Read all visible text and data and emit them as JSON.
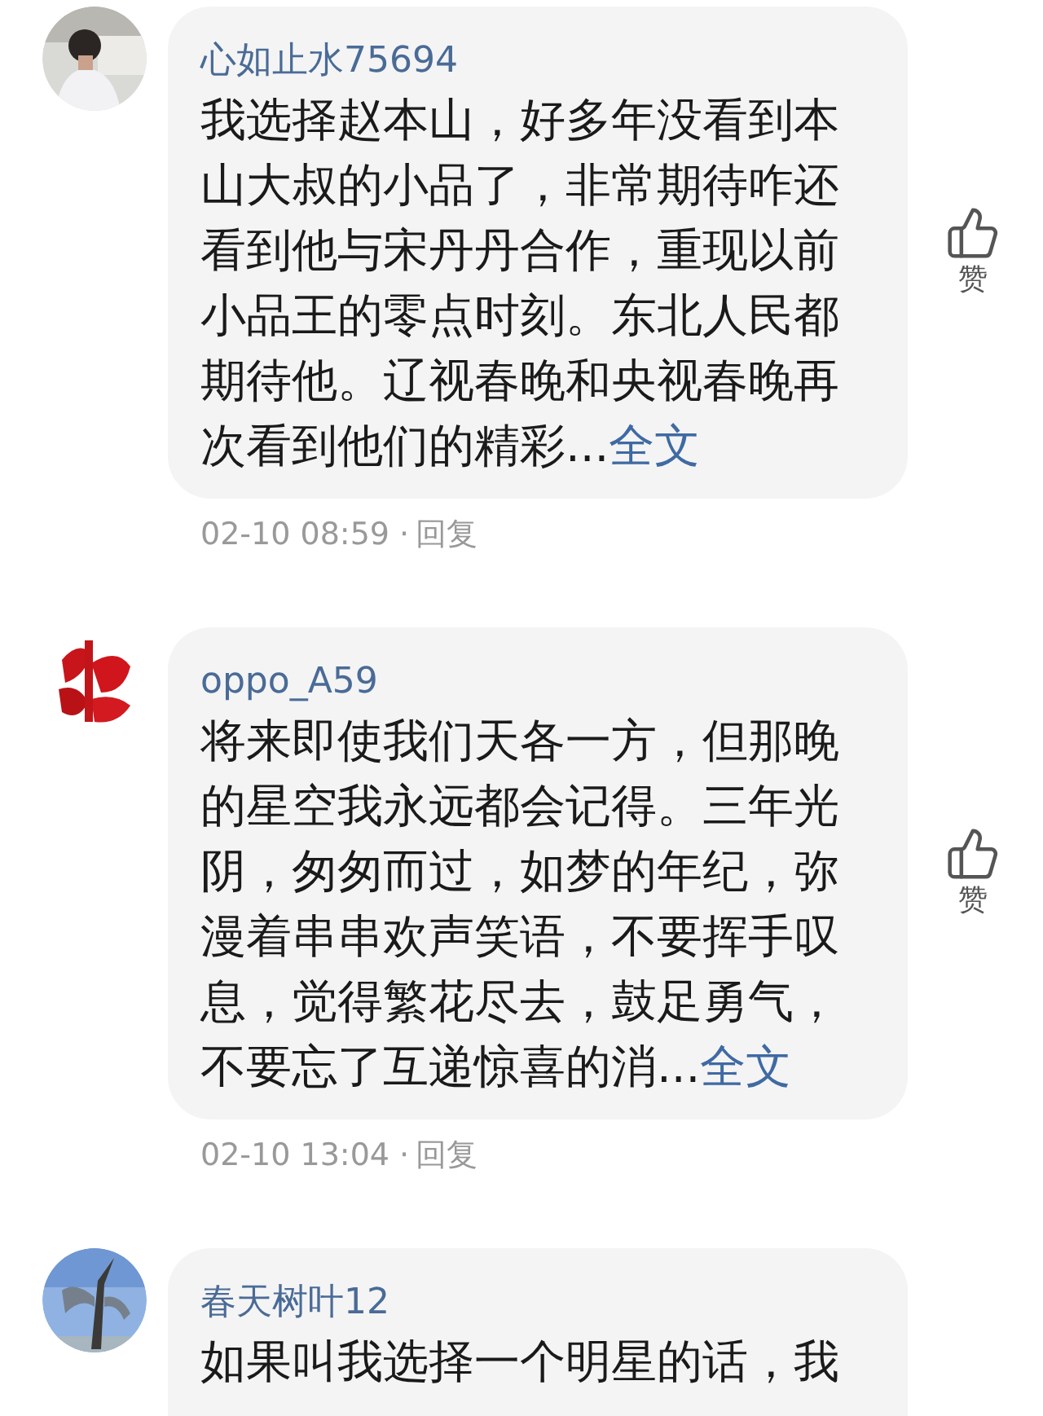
{
  "comments": [
    {
      "user": "心如止水75694",
      "text": "我选择赵本山，好多年没看到本山大叔的小品了，非常期待咋还看到他与宋丹丹合作，重现以前小品王的零点时刻。东北人民都期待他。辽视春晚和央视春晚再次看到他们的精彩...",
      "more_link": "全文",
      "time": "02-10 08:59 ·",
      "reply": "回复",
      "like_label": "赞"
    },
    {
      "user": "oppo_A59",
      "text": "将来即使我们天各一方，但那晚的星空我永远都会记得。三年光阴，匆匆而过，如梦的年纪，弥漫着串串欢声笑语，不要挥手叹息，觉得繁花尽去，鼓足勇气，不要忘了互递惊喜的消...",
      "more_link": "全文",
      "time": "02-10 13:04 ·",
      "reply": "回复",
      "like_label": "赞"
    },
    {
      "user": "春天树叶12",
      "text": "如果叫我选择一个明星的话，我"
    }
  ]
}
